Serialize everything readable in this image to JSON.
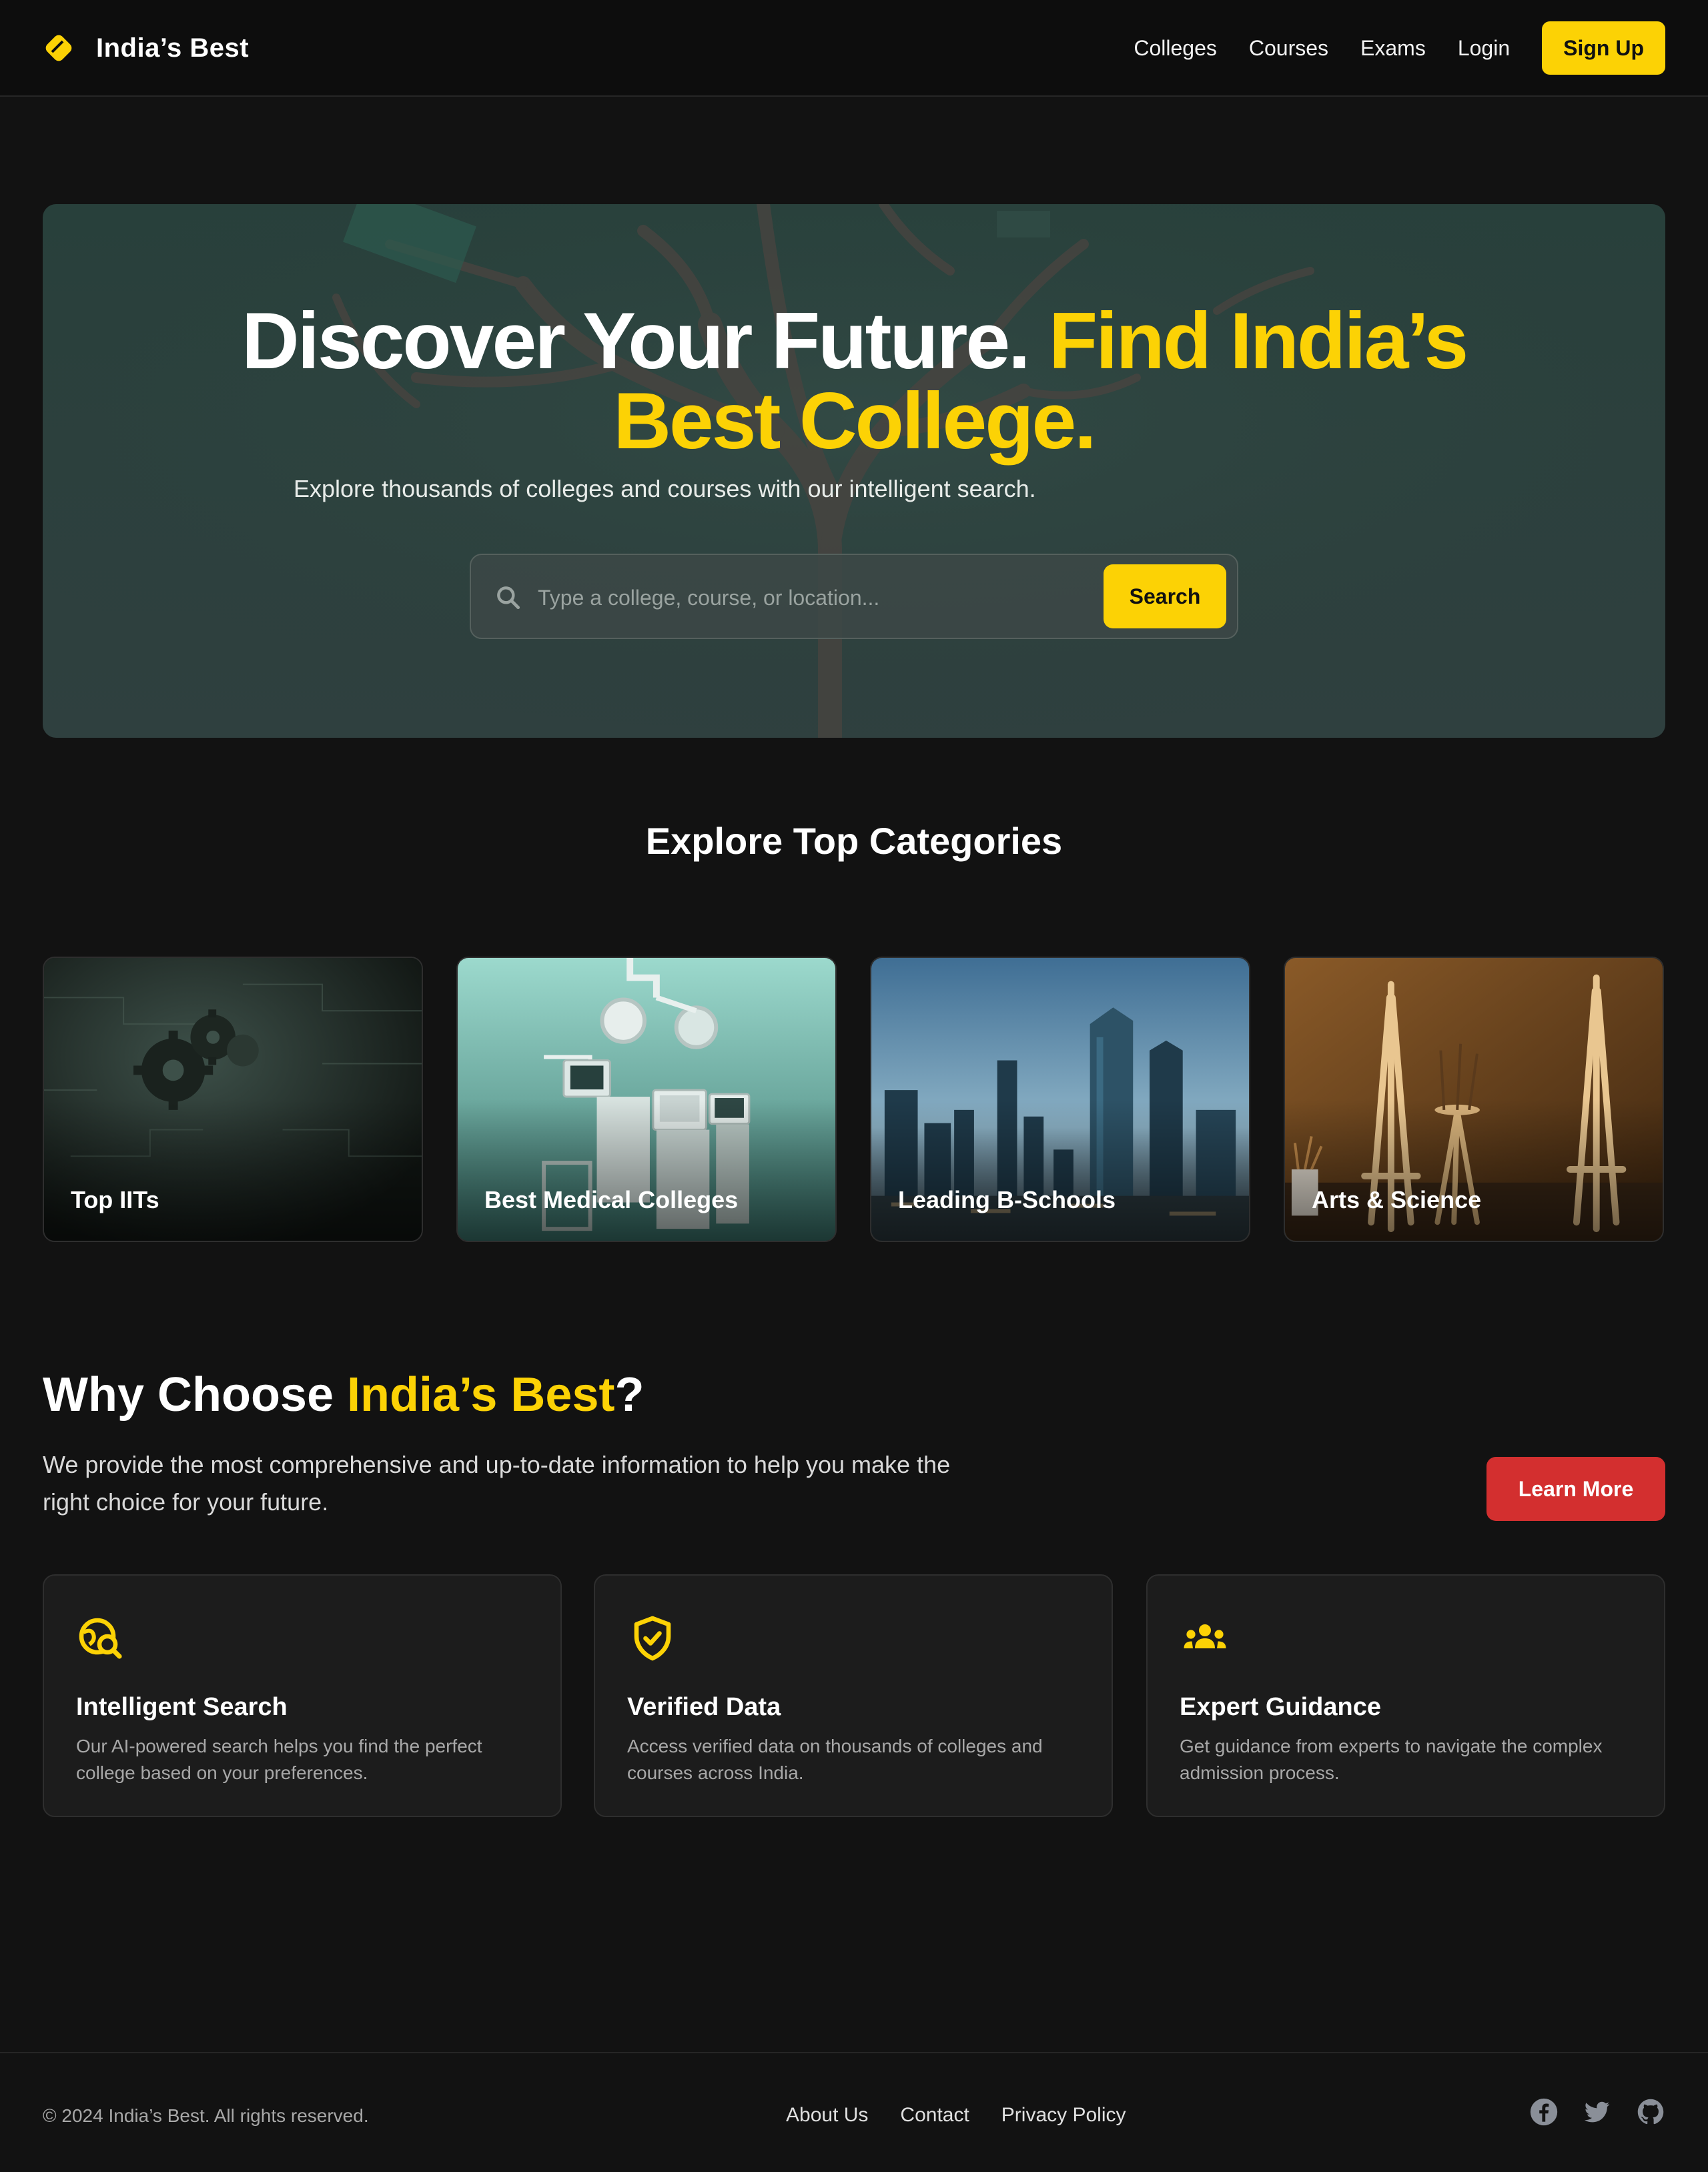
{
  "header": {
    "brand": "India’s Best",
    "nav": [
      "Colleges",
      "Courses",
      "Exams",
      "Login"
    ],
    "signup_label": "Sign Up"
  },
  "hero": {
    "title_white": "Discover Your Future.",
    "title_accent_line1": "Find India’s",
    "title_accent_line2": "Best College.",
    "subtitle": "Explore thousands of colleges and courses with our intelligent search.",
    "search_placeholder": "Type a college, course, or location...",
    "search_button": "Search"
  },
  "categories": {
    "title": "Explore Top Categories",
    "items": [
      {
        "label": "Top IITs"
      },
      {
        "label": "Best Medical Colleges"
      },
      {
        "label": "Leading B-Schools"
      },
      {
        "label": "Arts & Science"
      }
    ]
  },
  "why": {
    "title_prefix": "Why Choose ",
    "title_accent": "India’s Best",
    "title_suffix": "?",
    "description": "We provide the most comprehensive and up-to-date information to help you make the right choice for your future.",
    "learn_more": "Learn More",
    "features": [
      {
        "icon": "search-globe-icon",
        "title": "Intelligent Search",
        "desc": "Our AI-powered search helps you find the perfect college based on your preferences."
      },
      {
        "icon": "shield-check-icon",
        "title": "Verified Data",
        "desc": "Access verified data on thousands of colleges and courses across India."
      },
      {
        "icon": "group-icon",
        "title": "Expert Guidance",
        "desc": "Get guidance from experts to navigate the complex admission process."
      }
    ]
  },
  "footer": {
    "copyright": "© 2024 India’s Best. All rights reserved.",
    "links": [
      "About Us",
      "Contact",
      "Privacy Policy"
    ],
    "socials": [
      "facebook-icon",
      "twitter-icon",
      "github-icon"
    ]
  },
  "colors": {
    "accent": "#fcd205",
    "background": "#121212",
    "danger": "#d32f2f",
    "card": "#1c1c1c"
  }
}
